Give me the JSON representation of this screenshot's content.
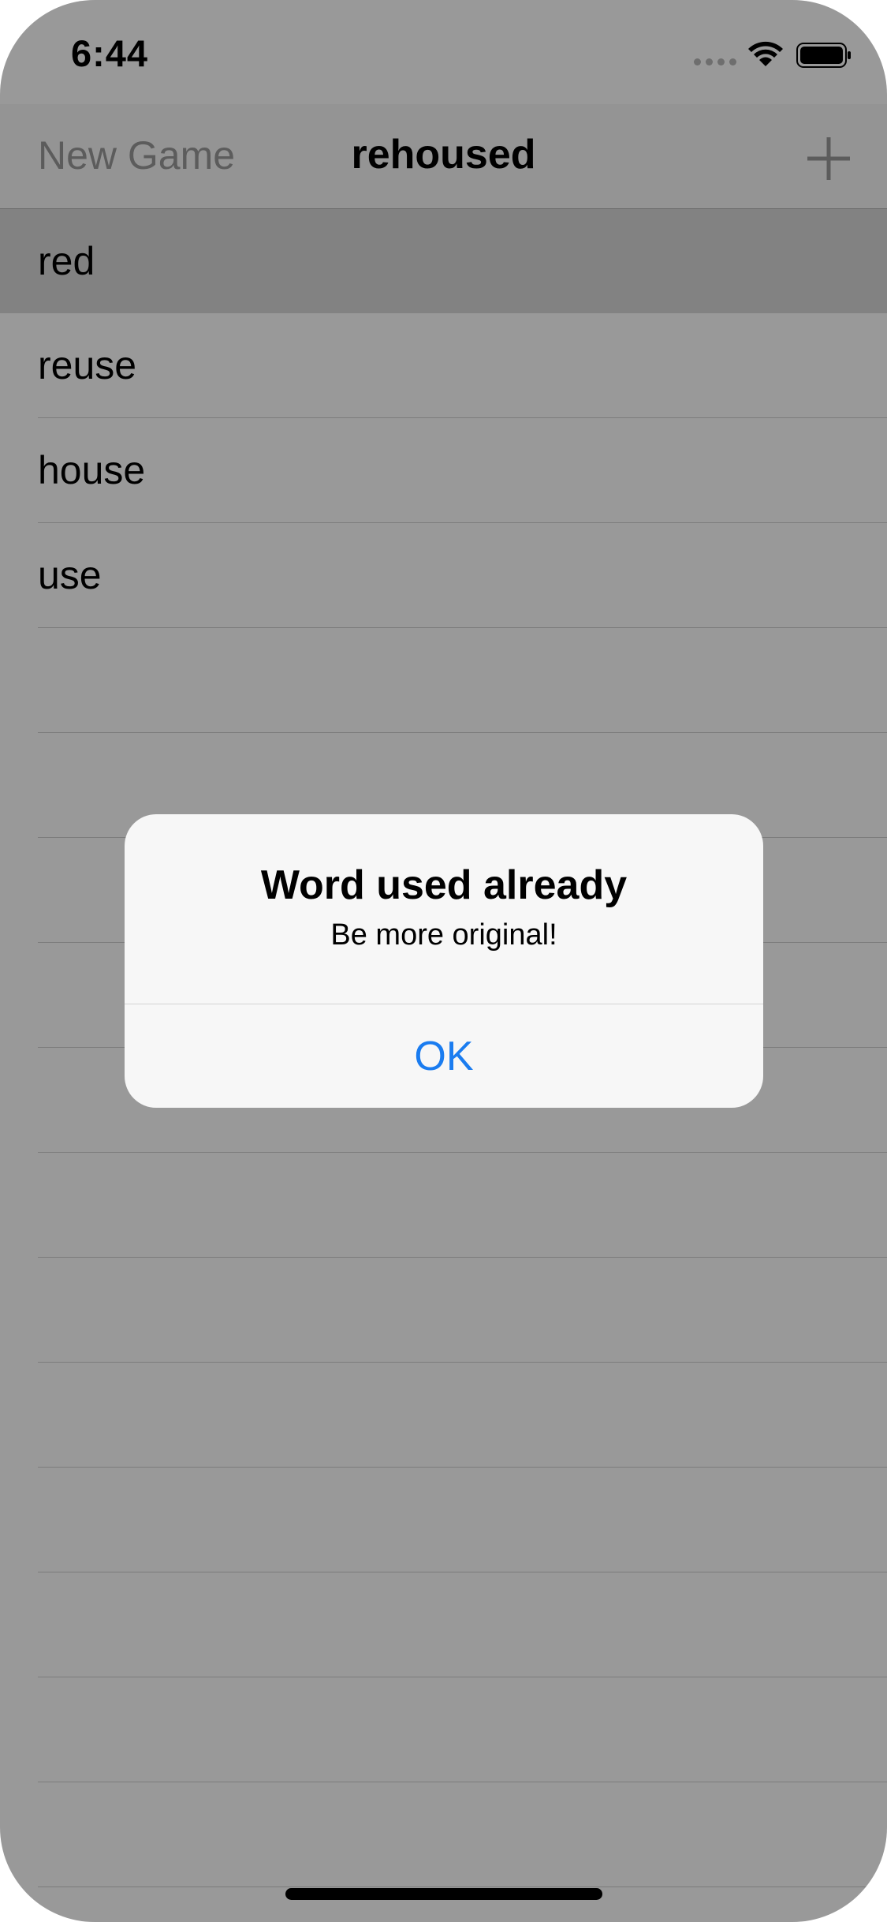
{
  "status_bar": {
    "time": "6:44"
  },
  "nav_bar": {
    "left_button": "New Game",
    "title": "rehoused",
    "right_icon": "plus-icon"
  },
  "words": [
    {
      "text": "red",
      "selected": true
    },
    {
      "text": "reuse",
      "selected": false
    },
    {
      "text": "house",
      "selected": false
    },
    {
      "text": "use",
      "selected": false
    }
  ],
  "alert": {
    "title": "Word used already",
    "message": "Be more original!",
    "button": "OK"
  },
  "colors": {
    "tint": "#1a7cf0",
    "dim": "rgba(0,0,0,0.40)"
  }
}
